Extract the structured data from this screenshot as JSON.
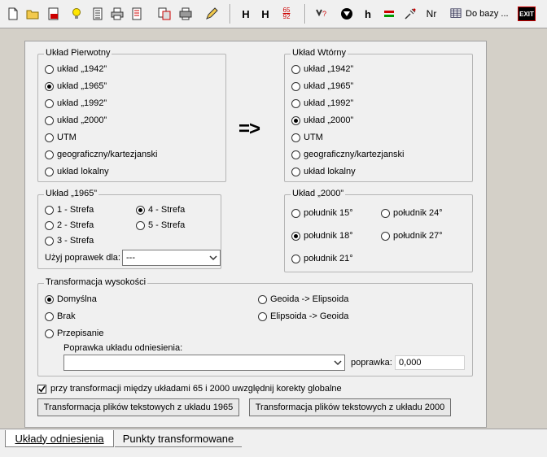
{
  "toolbar": {
    "btn_h1": "H",
    "btn_h2": "H",
    "btn_6592_top": "65",
    "btn_6592_bottom": "92",
    "btn_h3": "h",
    "btn_nr": "Nr",
    "db_label": "Do bazy ...",
    "exit_label": "EXIT"
  },
  "primary": {
    "legend": "Układ Pierwotny",
    "options": [
      "układ „1942”",
      "układ „1965”",
      "układ „1992”",
      "układ „2000”",
      "UTM",
      "geograficzny/kartezjanski",
      "układ lokalny"
    ],
    "selected_index": 1
  },
  "arrow": "=>",
  "secondary": {
    "legend": "Układ Wtórny",
    "options": [
      "układ „1942”",
      "układ „1965”",
      "układ „1992”",
      "układ „2000”",
      "UTM",
      "geograficzny/kartezjanski",
      "układ lokalny"
    ],
    "selected_index": 3
  },
  "zone1965": {
    "legend": "Układ „1965”",
    "zones": [
      "1 - Strefa",
      "2 - Strefa",
      "3 - Strefa",
      "4 - Strefa",
      "5 - Strefa"
    ],
    "selected": "4 - Strefa",
    "correction_label": "Użyj poprawek dla:",
    "correction_value": "---"
  },
  "meridian2000": {
    "legend": "Układ „2000”",
    "meridians": [
      "południk 15°",
      "południk 18°",
      "południk 21°",
      "południk 24°",
      "południk 27°"
    ],
    "selected": "południk 18°"
  },
  "height": {
    "legend": "Transformacja wysokości",
    "options_left": [
      "Domyślna",
      "Brak",
      "Przepisanie"
    ],
    "options_right": [
      "Geoida -> Elipsoida",
      "Elipsoida -> Geoida"
    ],
    "selected": "Domyślna",
    "datum_label": "Poprawka układu odniesienia:",
    "datum_value": "",
    "correction_label": "poprawka:",
    "correction_value": "0,000"
  },
  "global_check": {
    "label": "przy transformacji między układami 65 i 2000 uwzględnij korekty globalne",
    "checked": true
  },
  "buttons": {
    "from1965": "Transformacja plików tekstowych z układu 1965",
    "from2000": "Transformacja plików tekstowych z układu 2000"
  },
  "tabs": {
    "active": "Układy odniesienia",
    "other": "Punkty transformowane"
  }
}
